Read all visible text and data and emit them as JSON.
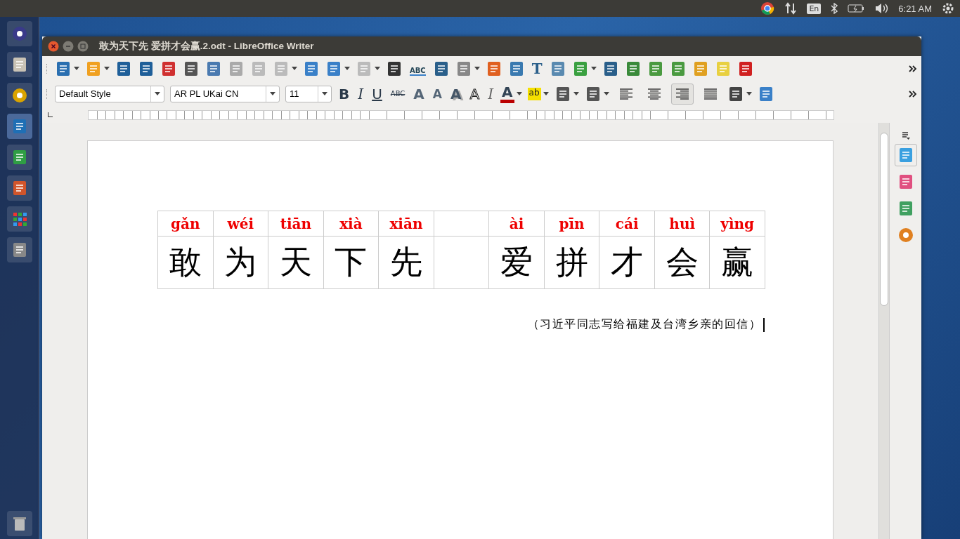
{
  "top_panel": {
    "keyboard_layout": "En",
    "clock": "6:21 AM"
  },
  "window": {
    "title": "敢为天下先 爱拼才会赢.2.odt - LibreOffice Writer"
  },
  "standard_bar": {
    "spellcheck_glyph": "ABC",
    "textbox_glyph": "T"
  },
  "formatting_bar": {
    "paragraph_style": "Default Style",
    "font_name": "AR PL UKai CN",
    "font_size": "11",
    "format_buttons": [
      {
        "glyph": "B",
        "kind": "bold"
      },
      {
        "glyph": "I",
        "kind": "italic"
      },
      {
        "glyph": "U",
        "kind": "underline"
      },
      {
        "glyph": "ABC",
        "kind": "strikethrough"
      },
      {
        "glyph": "A",
        "kind": "grow"
      },
      {
        "glyph": "A",
        "kind": "shrink"
      },
      {
        "glyph": "A",
        "kind": "shadow"
      },
      {
        "glyph": "A",
        "kind": "outline"
      },
      {
        "glyph": "I",
        "kind": "clear"
      },
      {
        "glyph": "A",
        "kind": "font_color"
      },
      {
        "glyph": "ab",
        "kind": "highlight"
      }
    ],
    "alignment": [
      {
        "selected": false
      },
      {
        "selected": false
      },
      {
        "selected": true
      },
      {
        "selected": false
      }
    ]
  },
  "document": {
    "ruby_table": [
      {
        "kind": "char",
        "pinyin": "gǎn",
        "hanzi": "敢"
      },
      {
        "kind": "char",
        "pinyin": "wéi",
        "hanzi": "为"
      },
      {
        "kind": "char",
        "pinyin": "tiān",
        "hanzi": "天"
      },
      {
        "kind": "char",
        "pinyin": "xià",
        "hanzi": "下"
      },
      {
        "kind": "char",
        "pinyin": "xiān",
        "hanzi": "先"
      },
      {
        "kind": "empty"
      },
      {
        "kind": "char",
        "pinyin": "ài",
        "hanzi": "爱"
      },
      {
        "kind": "char",
        "pinyin": "pīn",
        "hanzi": "拼"
      },
      {
        "kind": "char",
        "pinyin": "cái",
        "hanzi": "才"
      },
      {
        "kind": "char",
        "pinyin": "huì",
        "hanzi": "会"
      },
      {
        "kind": "char",
        "pinyin": "yìng",
        "hanzi": "赢"
      }
    ],
    "caption": "（习近平同志写给福建及台湾乡亲的回信）",
    "text_cursor": true
  }
}
